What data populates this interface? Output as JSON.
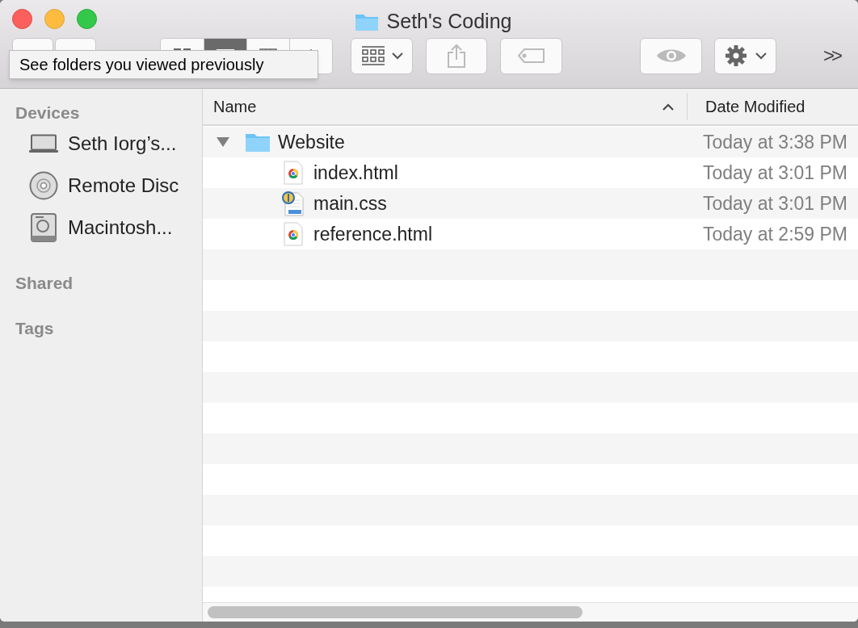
{
  "window": {
    "title": "Seth's Coding"
  },
  "toolbar": {
    "view_modes": [
      {
        "kind": "icon",
        "selected": false
      },
      {
        "kind": "list",
        "selected": true
      },
      {
        "kind": "columns",
        "selected": false
      },
      {
        "kind": "flow",
        "selected": false
      }
    ],
    "overflow": ">>"
  },
  "tooltip": "See folders you viewed previously",
  "sidebar": {
    "sections": [
      {
        "title": "Devices",
        "items": [
          {
            "label": "Seth Iorg’s...",
            "kind": "laptop"
          },
          {
            "label": "Remote Disc",
            "kind": "disc"
          },
          {
            "label": "Macintosh...",
            "kind": "drive"
          }
        ]
      },
      {
        "title": "Shared"
      },
      {
        "title": "Tags"
      }
    ]
  },
  "table": {
    "columns": [
      {
        "label": "Name",
        "sorted": true
      },
      {
        "label": "Date Modified",
        "sorted": false
      }
    ],
    "rows": [
      {
        "name": "Website",
        "kind": "folder",
        "expanded": true,
        "date": "Today at 3:38 PM",
        "children": [
          {
            "name": "index.html",
            "kind": "html",
            "date": "Today at 3:01 PM"
          },
          {
            "name": "main.css",
            "kind": "css",
            "date": "Today at 3:01 PM"
          },
          {
            "name": "reference.html",
            "kind": "html",
            "date": "Today at 2:59 PM"
          }
        ]
      }
    ]
  }
}
